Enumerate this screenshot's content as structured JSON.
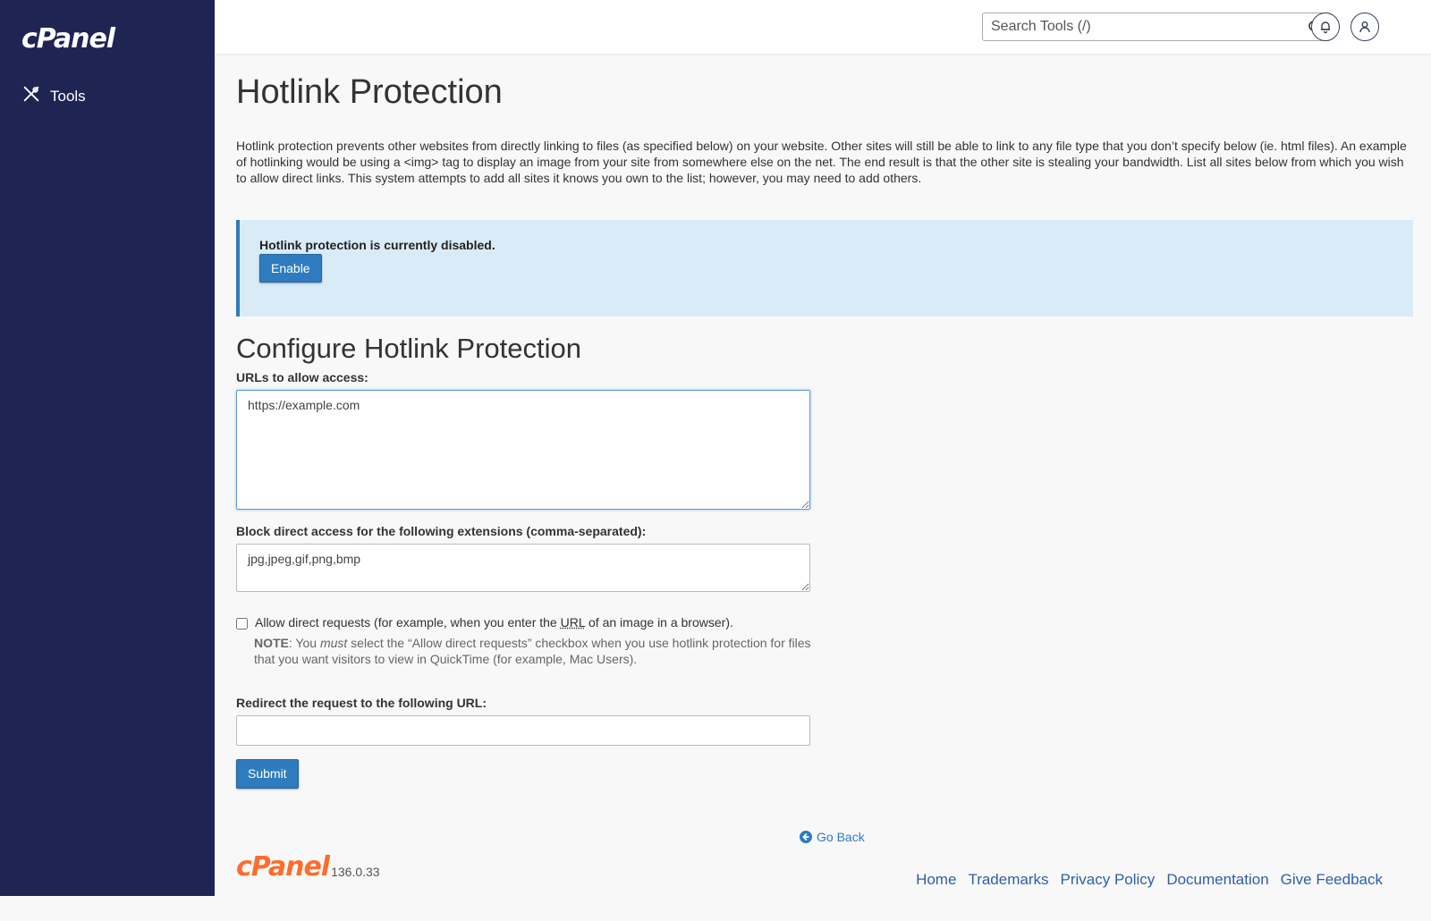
{
  "sidebar": {
    "logo": "cPanel",
    "nav_tools": "Tools"
  },
  "topbar": {
    "search_placeholder": "Search Tools (/)"
  },
  "page": {
    "title": "Hotlink Protection",
    "intro": "Hotlink protection prevents other websites from directly linking to files (as specified below) on your website. Other sites will still be able to link to any file type that you don’t specify below (ie. html files). An example of hotlinking would be using a <img> tag to display an image from your site from somewhere else on the net. The end result is that the other site is stealing your bandwidth. List all sites below from which you wish to allow direct links. This system attempts to add all sites it knows you own to the list; however, you may need to add others."
  },
  "status": {
    "text": "Hotlink protection is currently disabled.",
    "enable_label": "Enable"
  },
  "config": {
    "title": "Configure Hotlink Protection",
    "urls_label": "URLs to allow access:",
    "urls_value": "https://example.com",
    "ext_label": "Block direct access for the following extensions (comma-separated):",
    "ext_value": "jpg,jpeg,gif,png,bmp",
    "allow_direct_prefix": "Allow direct requests (for example, when you enter the ",
    "allow_direct_abbr": "URL",
    "allow_direct_suffix": " of an image in a browser).",
    "allow_direct_checked": false,
    "note_label": "NOTE",
    "note_pre": ": You ",
    "note_em": "must",
    "note_post": " select the “Allow direct requests” checkbox when you use hotlink protection for files that you want visitors to view in QuickTime (for example, Mac Users).",
    "redirect_label": "Redirect the request to the following URL:",
    "redirect_value": "",
    "submit_label": "Submit"
  },
  "go_back": "Go Back",
  "footer": {
    "brand": "cPanel",
    "version": "136.0.33",
    "links": [
      "Home",
      "Trademarks",
      "Privacy Policy",
      "Documentation",
      "Give Feedback"
    ]
  },
  "colors": {
    "sidebar": "#1f2553",
    "accent": "#2f7bbf",
    "callout_bg": "#d8ebf7",
    "brand_orange": "#ff6c2c"
  }
}
